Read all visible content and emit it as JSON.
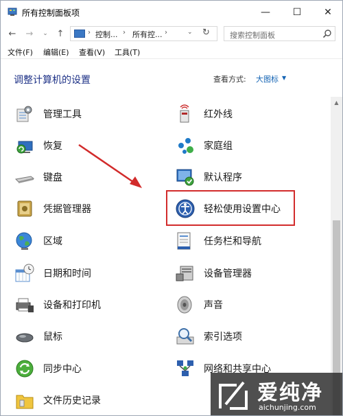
{
  "window": {
    "title": "所有控制面板项",
    "controls": {
      "minimize": "—",
      "maximize": "☐",
      "close": "✕"
    }
  },
  "nav": {
    "back": "←",
    "forward": "→",
    "recent": "⌄",
    "up": "↑",
    "breadcrumb": [
      "控制...",
      "所有控..."
    ],
    "separator": "›",
    "dropdown": "⌄",
    "refresh": "↻",
    "search_placeholder": "搜索控制面板"
  },
  "menu": [
    "文件(F)",
    "编辑(E)",
    "查看(V)",
    "工具(T)"
  ],
  "header": {
    "title": "调整计算机的设置",
    "view_by_label": "查看方式:",
    "view_by_value": "大图标",
    "view_by_arrow": "▼"
  },
  "items_left": [
    {
      "label": "管理工具",
      "icon": "admin-tools-icon"
    },
    {
      "label": "恢复",
      "icon": "recovery-icon"
    },
    {
      "label": "键盘",
      "icon": "keyboard-icon"
    },
    {
      "label": "凭据管理器",
      "icon": "credential-manager-icon"
    },
    {
      "label": "区域",
      "icon": "region-icon"
    },
    {
      "label": "日期和时间",
      "icon": "date-time-icon"
    },
    {
      "label": "设备和打印机",
      "icon": "devices-printers-icon"
    },
    {
      "label": "鼠标",
      "icon": "mouse-icon"
    },
    {
      "label": "同步中心",
      "icon": "sync-center-icon"
    },
    {
      "label": "文件历史记录",
      "icon": "file-history-icon"
    }
  ],
  "items_right": [
    {
      "label": "红外线",
      "icon": "infrared-icon"
    },
    {
      "label": "家庭组",
      "icon": "homegroup-icon"
    },
    {
      "label": "默认程序",
      "icon": "default-programs-icon"
    },
    {
      "label": "轻松使用设置中心",
      "icon": "ease-of-access-icon"
    },
    {
      "label": "任务栏和导航",
      "icon": "taskbar-navigation-icon"
    },
    {
      "label": "设备管理器",
      "icon": "device-manager-icon"
    },
    {
      "label": "声音",
      "icon": "sound-icon"
    },
    {
      "label": "索引选项",
      "icon": "indexing-options-icon"
    },
    {
      "label": "网络和共享中心",
      "icon": "network-sharing-icon"
    }
  ],
  "scrollbar": {
    "up": "▲"
  },
  "watermark": {
    "text": "爱纯净",
    "domain": "aichunjing.com"
  },
  "colors": {
    "title_blue": "#1e3287",
    "link_blue": "#1464b4",
    "highlight_red": "#d22b2b"
  }
}
